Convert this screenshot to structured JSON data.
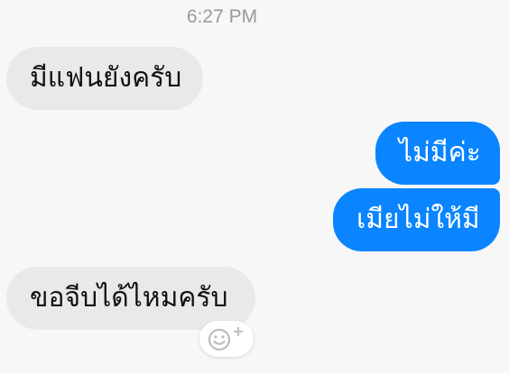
{
  "timestamp": "6:27 PM",
  "messages": [
    {
      "direction": "incoming",
      "text": "มีแฟนยังครับ"
    },
    {
      "direction": "outgoing",
      "text": "ไม่มีค่ะ"
    },
    {
      "direction": "outgoing",
      "text": "เมียไม่ให้มี"
    },
    {
      "direction": "incoming",
      "text": "ขอจีบได้ไหมครับ"
    }
  ],
  "reaction_icon": "add-reaction-icon",
  "colors": {
    "background": "#f7f7f7",
    "incoming_bubble": "#e9e9e9",
    "outgoing_bubble": "#0a84ff",
    "timestamp_text": "#9a9a9a"
  }
}
